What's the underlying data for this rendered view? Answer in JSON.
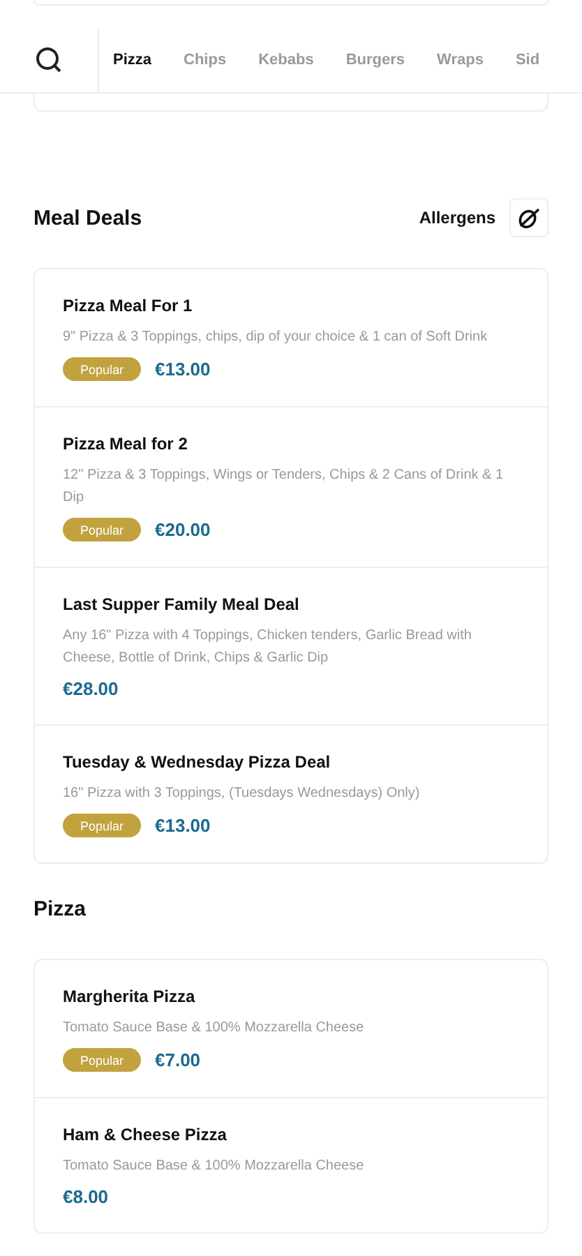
{
  "categories": [
    {
      "label": "Pizza",
      "selected": true
    },
    {
      "label": "Chips",
      "selected": false
    },
    {
      "label": "Kebabs",
      "selected": false
    },
    {
      "label": "Burgers",
      "selected": false
    },
    {
      "label": "Wraps",
      "selected": false
    },
    {
      "label": "Sid",
      "selected": false
    }
  ],
  "sections": [
    {
      "title": "Meal Deals",
      "allergens_label": "Allergens",
      "items": [
        {
          "name": "Pizza Meal For 1",
          "description": "9\" Pizza & 3 Toppings, chips, dip of your choice & 1 can of Soft Drink",
          "badge": "Popular",
          "price": "€13.00"
        },
        {
          "name": "Pizza Meal for 2",
          "description": "12\" Pizza & 3 Toppings, Wings or Tenders, Chips & 2 Cans of Drink & 1 Dip",
          "badge": "Popular",
          "price": "€20.00"
        },
        {
          "name": "Last Supper Family Meal Deal",
          "description": "Any 16\" Pizza with 4 Toppings, Chicken tenders, Garlic Bread with Cheese, Bottle of Drink, Chips & Garlic Dip",
          "price": "€28.00"
        },
        {
          "name": "Tuesday & Wednesday Pizza Deal",
          "description": "16\" Pizza with 3 Toppings, (Tuesdays Wednesdays) Only)",
          "badge": "Popular",
          "price": "€13.00"
        }
      ]
    },
    {
      "title": "Pizza",
      "items": [
        {
          "name": "Margherita Pizza",
          "description": "Tomato Sauce Base & 100% Mozzarella Cheese",
          "badge": "Popular",
          "price": "€7.00"
        },
        {
          "name": "Ham & Cheese Pizza",
          "description": "Tomato Sauce Base & 100% Mozzarella Cheese",
          "price": "€8.00"
        }
      ]
    }
  ]
}
